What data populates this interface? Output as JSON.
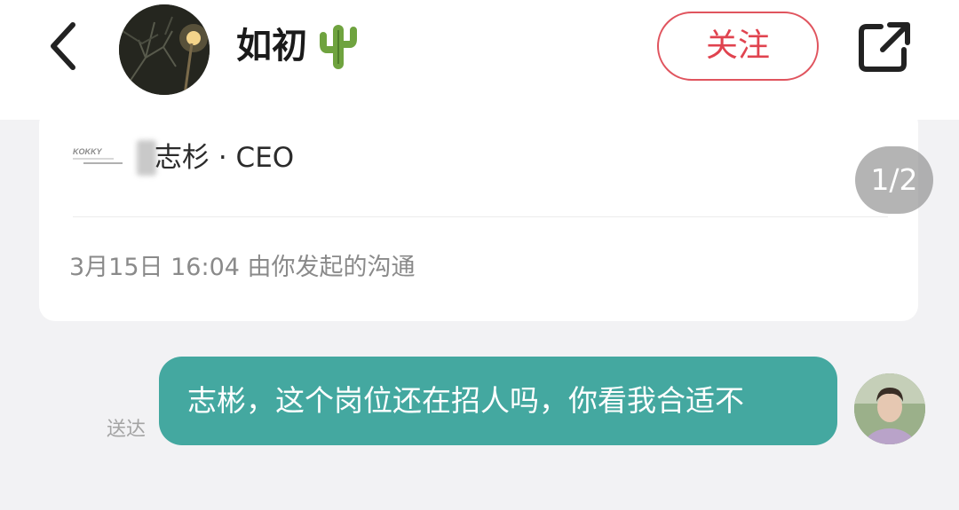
{
  "header": {
    "contact_name": "如初",
    "follow_label": "关注",
    "icons": {
      "back": "chevron-left-icon",
      "name_emoji": "cactus-icon",
      "share": "share-external-icon"
    }
  },
  "card": {
    "title": "志杉 · CEO",
    "meta": "3月15日 16:04 由你发起的沟通",
    "page_indicator": "1/2",
    "logo_text": "KOKKY"
  },
  "message": {
    "text": "志彬，这个岗位还在招人吗，你看我合适不",
    "status": "送达"
  },
  "colors": {
    "bubble": "#44a8a0",
    "follow_accent": "#e0434f",
    "background": "#f2f2f4"
  }
}
